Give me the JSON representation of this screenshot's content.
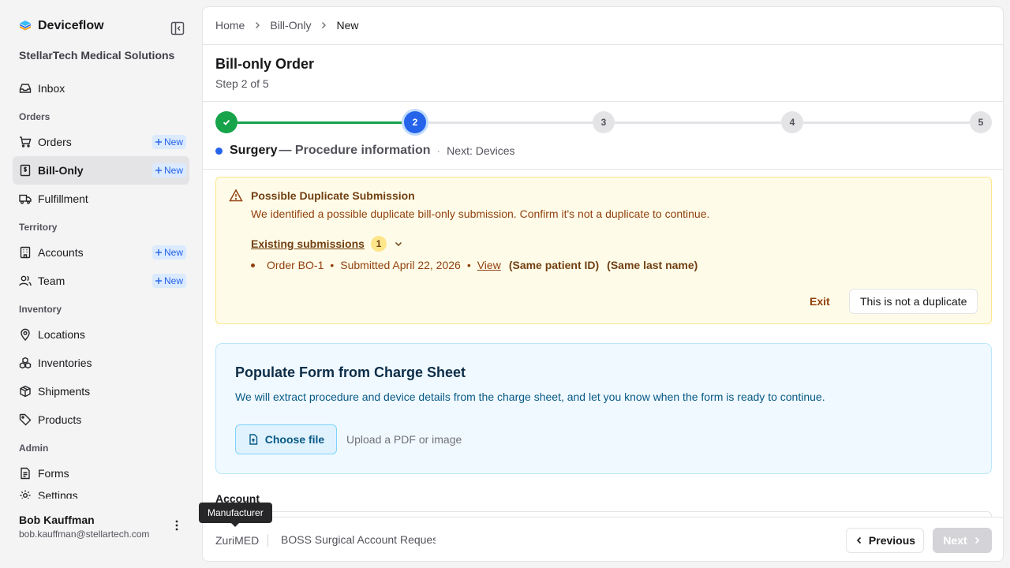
{
  "brand": {
    "name": "Deviceflow"
  },
  "org": {
    "name": "StellarTech Medical Solutions"
  },
  "nav": {
    "inbox": "Inbox",
    "group_orders": "Orders",
    "orders": "Orders",
    "bill_only": "Bill-Only",
    "fulfillment": "Fulfillment",
    "group_territory": "Territory",
    "accounts": "Accounts",
    "team": "Team",
    "group_inventory": "Inventory",
    "locations": "Locations",
    "inventories": "Inventories",
    "shipments": "Shipments",
    "products": "Products",
    "group_admin": "Admin",
    "forms": "Forms",
    "settings": "Settings",
    "new_label": "New"
  },
  "user": {
    "name": "Bob Kauffman",
    "email": "bob.kauffman@stellartech.com"
  },
  "breadcrumb": {
    "home": "Home",
    "section": "Bill-Only",
    "current": "New"
  },
  "page": {
    "title": "Bill-only Order",
    "step": "Step 2 of 5"
  },
  "stepper": {
    "steps": [
      "1",
      "2",
      "3",
      "4",
      "5"
    ],
    "current_index": 1,
    "caption_title": "Surgery",
    "caption_sub": "— Procedure information",
    "caption_mid": "·",
    "caption_next": "Next: Devices"
  },
  "warning": {
    "title": "Possible Duplicate Submission",
    "text": "We identified a possible duplicate bill-only submission. Confirm it's not a duplicate to continue.",
    "existing_label": "Existing submissions",
    "count": "1",
    "item_order": "Order BO-1",
    "item_sep": "•",
    "item_submitted": "Submitted April 22, 2026",
    "item_view": "View",
    "tag_patient": "(Same patient ID)",
    "tag_last_name": "(Same last name)",
    "exit_label": "Exit",
    "not_dup_label": "This is not a duplicate"
  },
  "charge_sheet": {
    "title": "Populate Form from Charge Sheet",
    "text": "We will extract procedure and device details from the charge sheet, and let you know when the form is ready to continue.",
    "choose_label": "Choose file",
    "hint": "Upload a PDF or image"
  },
  "account": {
    "label": "Account"
  },
  "footer": {
    "manufacturer": "ZuriMED",
    "account": "BOSS Surgical Account Request",
    "previous_label": "Previous",
    "next_label": "Next"
  },
  "tooltip": {
    "text": "Manufacturer"
  },
  "colors": {
    "accent": "#2563eb",
    "success": "#16a34a",
    "warning_bg": "#fefce8",
    "info_bg": "#f0f9ff"
  }
}
